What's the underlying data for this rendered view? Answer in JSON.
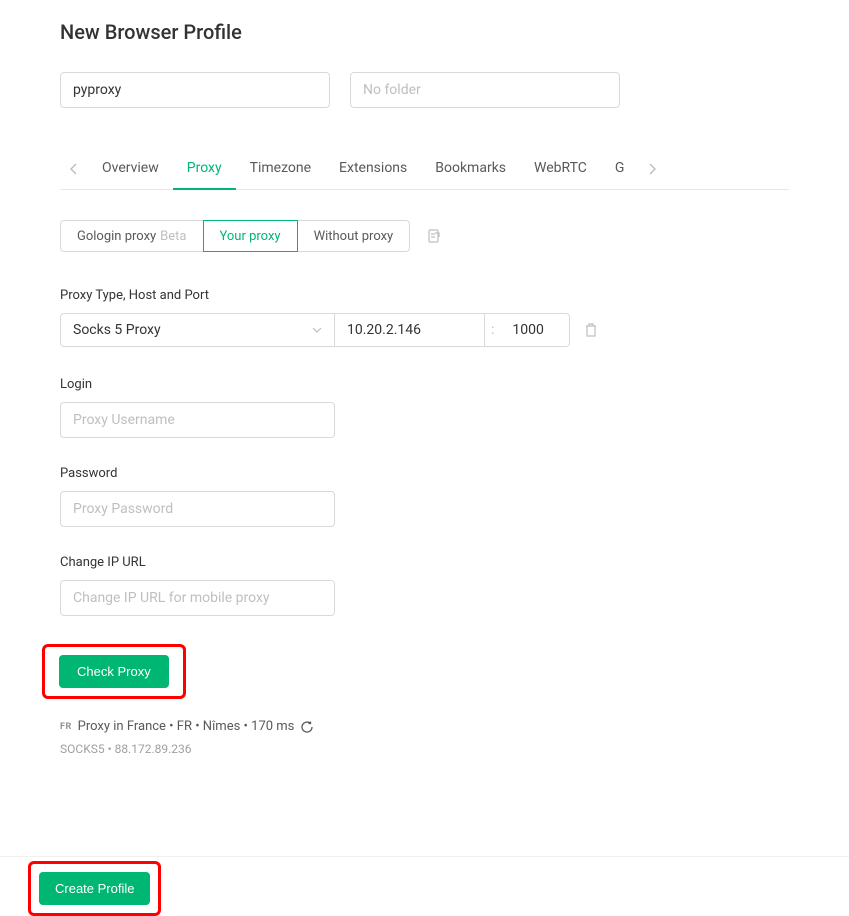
{
  "header": {
    "title": "New Browser Profile"
  },
  "profile": {
    "name": "pyproxy",
    "folder_placeholder": "No folder"
  },
  "tabs": {
    "items": [
      "Overview",
      "Proxy",
      "Timezone",
      "Extensions",
      "Bookmarks",
      "WebRTC",
      "G"
    ],
    "active_index": 1
  },
  "proxy_modes": {
    "gologin": "Gologin proxy",
    "gologin_beta": "Beta",
    "your_proxy": "Your proxy",
    "without_proxy": "Without proxy",
    "active_index": 1
  },
  "proxy_config": {
    "type_host_port_label": "Proxy Type, Host and Port",
    "proxy_type": "Socks 5 Proxy",
    "host": "10.20.2.146",
    "port_separator": ":",
    "port": "1000",
    "login_label": "Login",
    "login_placeholder": "Proxy Username",
    "password_label": "Password",
    "password_placeholder": "Proxy Password",
    "change_ip_label": "Change IP URL",
    "change_ip_placeholder": "Change IP URL for mobile proxy",
    "check_proxy_button": "Check Proxy"
  },
  "proxy_result": {
    "flag_code": "FR",
    "status_text": "Proxy in France • FR • Nîmes • 170 ms",
    "detail_text": "SOCKS5 • 88.172.89.236"
  },
  "footer": {
    "create_button": "Create Profile"
  }
}
